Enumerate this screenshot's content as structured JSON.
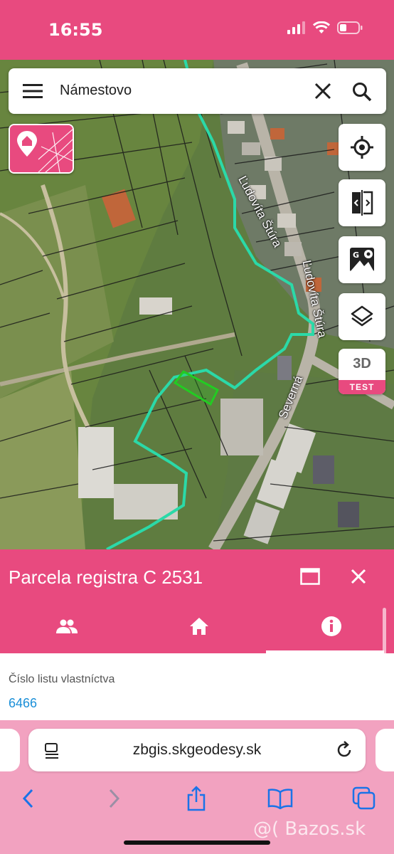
{
  "status_bar": {
    "time": "16:55"
  },
  "search": {
    "value": "Námestovo"
  },
  "map": {
    "street_labels": [
      "Ľudovíta Štúra",
      "Ľudovíta Štúra",
      "Severná"
    ]
  },
  "side_buttons": {
    "locate_icon": "crosshair-icon",
    "compare_icon": "split-view-icon",
    "google_maps_icon": "google-maps-icon",
    "layers_icon": "layers-icon",
    "three_d_label": "3D",
    "three_d_badge": "TEST"
  },
  "panel": {
    "title": "Parcela registra C 2531",
    "tabs": [
      {
        "icon": "people-icon",
        "active": false
      },
      {
        "icon": "home-icon",
        "active": false
      },
      {
        "icon": "info-icon",
        "active": true
      }
    ],
    "field_label": "Číslo listu vlastníctva",
    "field_value": "6466"
  },
  "browser": {
    "url": "zbgis.skgeodesy.sk"
  },
  "watermark": "@( Bazos.sk",
  "colors": {
    "brand": "#e84a7f",
    "link": "#1a8fd8",
    "parcel_outline": "#22cc22",
    "boundary": "#2bd9a8",
    "ios_blue": "#1a73e8"
  }
}
